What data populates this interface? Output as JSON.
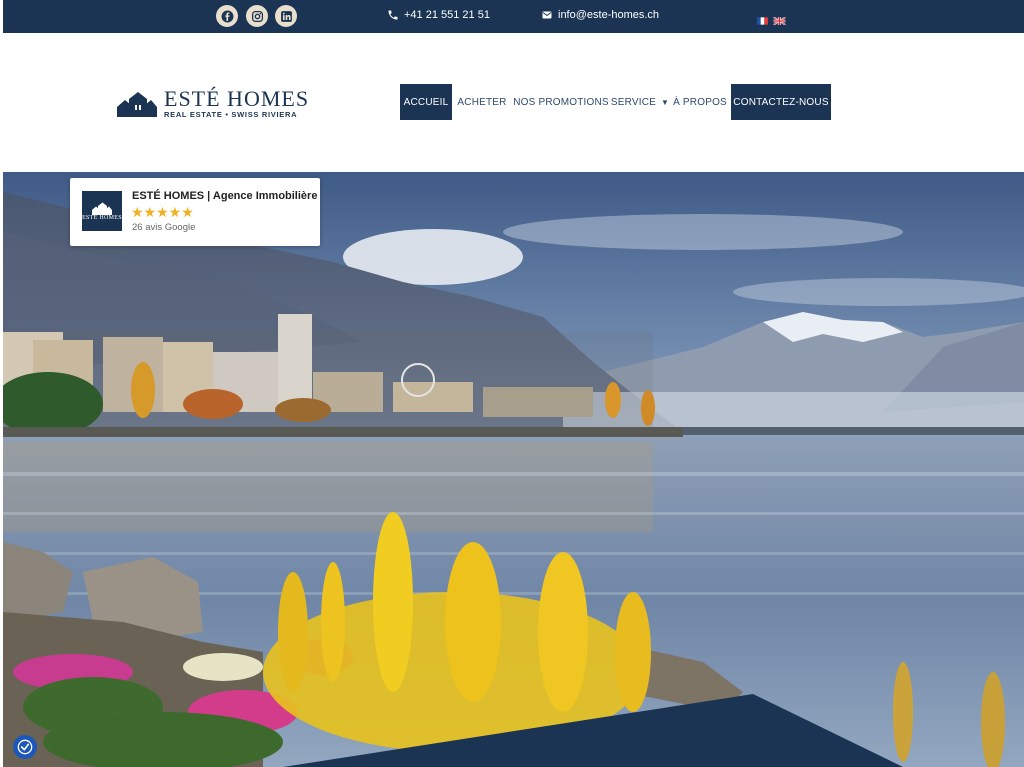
{
  "topbar": {
    "social": [
      {
        "name": "facebook-icon"
      },
      {
        "name": "instagram-icon"
      },
      {
        "name": "linkedin-icon"
      }
    ],
    "phone": "+41 21 551 21 51",
    "email": "info@este-homes.ch",
    "languages": [
      "fr",
      "en"
    ]
  },
  "logo": {
    "title": "ESTÉ HOMES",
    "subtitle": "REAL ESTATE • SWISS RIVIERA"
  },
  "nav": {
    "items": [
      "ACCUEIL",
      "ACHETER",
      "NOS PROMOTIONS",
      "SERVICE",
      "À PROPOS"
    ],
    "cta": "CONTACTEZ-NOUS",
    "active_index": 0
  },
  "review": {
    "name": "ESTÉ HOMES | Agence Immobilière",
    "stars": "★★★★★",
    "rating_stars": 5,
    "count": "26 avis Google"
  },
  "colors": {
    "navy": "#1b3453",
    "cream": "#e9dfcd",
    "star": "#f2b01e"
  }
}
